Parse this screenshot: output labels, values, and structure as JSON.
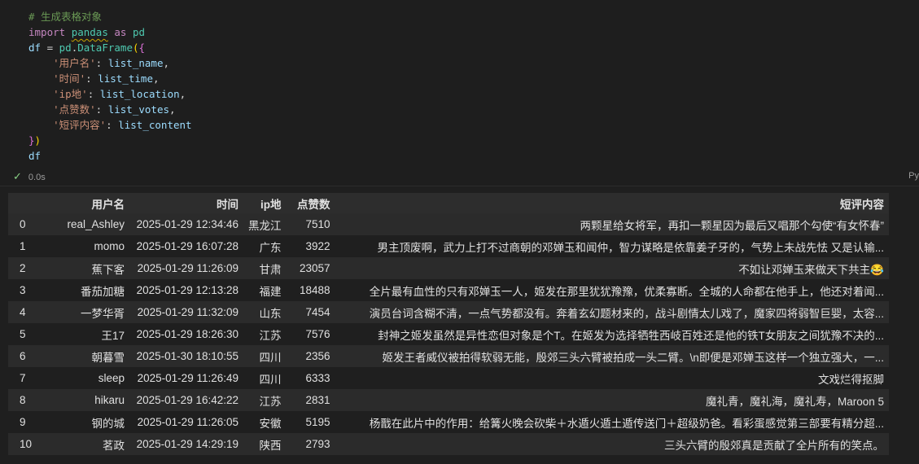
{
  "code": {
    "comment": "# 生成表格对象",
    "kw_import": "import",
    "module": "pandas",
    "kw_as": "as",
    "alias": "pd",
    "df_var": "df",
    "eq": " = ",
    "pd2": "pd",
    "dot": ".",
    "ctor": "DataFrame",
    "open_paren": "(",
    "open_brace": "{",
    "entries": [
      {
        "key": "'用户名'",
        "value": "list_name",
        "comma": ","
      },
      {
        "key": "'时间'",
        "value": "list_time",
        "comma": ","
      },
      {
        "key": "'ip地'",
        "value": "list_location",
        "comma": ","
      },
      {
        "key": "'点赞数'",
        "value": "list_votes",
        "comma": ","
      },
      {
        "key": "'短评内容'",
        "value": "list_content",
        "comma": ""
      }
    ],
    "close_brace": "}",
    "close_paren": ")",
    "last_line": "df"
  },
  "status": {
    "check_icon": "check-icon",
    "time": "0.0s",
    "language": "Py"
  },
  "table": {
    "headers": [
      "",
      "用户名",
      "时间",
      "ip地",
      "点赞数",
      "短评内容"
    ],
    "rows": [
      [
        "0",
        "real_Ashley",
        "2025-01-29 12:34:46",
        "黑龙江",
        "7510",
        "两颗星给女将军，再扣一颗星因为最后又唱那个勾使“有女怀春”"
      ],
      [
        "1",
        "momo",
        "2025-01-29 16:07:28",
        "广东",
        "3922",
        "男主顶废啊，武力上打不过商朝的邓婵玉和闻仲，智力谋略是依靠姜子牙的，气势上未战先怯 又是认输..."
      ],
      [
        "2",
        "蕉下客",
        "2025-01-29 11:26:09",
        "甘肃",
        "23057",
        "不如让邓婵玉来做天下共主😂"
      ],
      [
        "3",
        "番茄加糖",
        "2025-01-29 12:13:28",
        "福建",
        "18488",
        "全片最有血性的只有邓婵玉一人，姬发在那里犹犹豫豫，优柔寡断。全城的人命都在他手上，他还对着闻..."
      ],
      [
        "4",
        "一梦华胥",
        "2025-01-29 11:32:09",
        "山东",
        "7454",
        "演员台词含糊不清，一点气势都没有。奔着玄幻题材来的，战斗剧情太儿戏了，魔家四将弱智巨婴，太容..."
      ],
      [
        "5",
        "王17",
        "2025-01-29 18:26:30",
        "江苏",
        "7576",
        "封神之姬发虽然是异性恋但对象是个T。在姬发为选择牺牲西岐百姓还是他的铁T女朋友之间犹豫不决的..."
      ],
      [
        "6",
        "朝暮雪",
        "2025-01-30 18:10:55",
        "四川",
        "2356",
        "姬发王者威仪被拍得软弱无能，殷郊三头六臂被拍成一头二臂。\\n即便是邓婵玉这样一个独立强大，一..."
      ],
      [
        "7",
        "sleep",
        "2025-01-29 11:26:49",
        "四川",
        "6333",
        "文戏烂得抠脚"
      ],
      [
        "8",
        "hikaru",
        "2025-01-29 16:42:22",
        "江苏",
        "2831",
        "魔礼青，魔礼海，魔礼寿，Maroon 5"
      ],
      [
        "9",
        "钢的城",
        "2025-01-29 11:26:05",
        "安徽",
        "5195",
        "杨戬在此片中的作用：给篝火晚会砍柴＋水遁火遁土遁传送门＋超级奶爸。看彩蛋感觉第三部要有精分超..."
      ],
      [
        "10",
        "茗政",
        "2025-01-29 14:29:19",
        "陕西",
        "2793",
        "三头六臂的殷郊真是贡献了全片所有的笑点。"
      ]
    ]
  }
}
